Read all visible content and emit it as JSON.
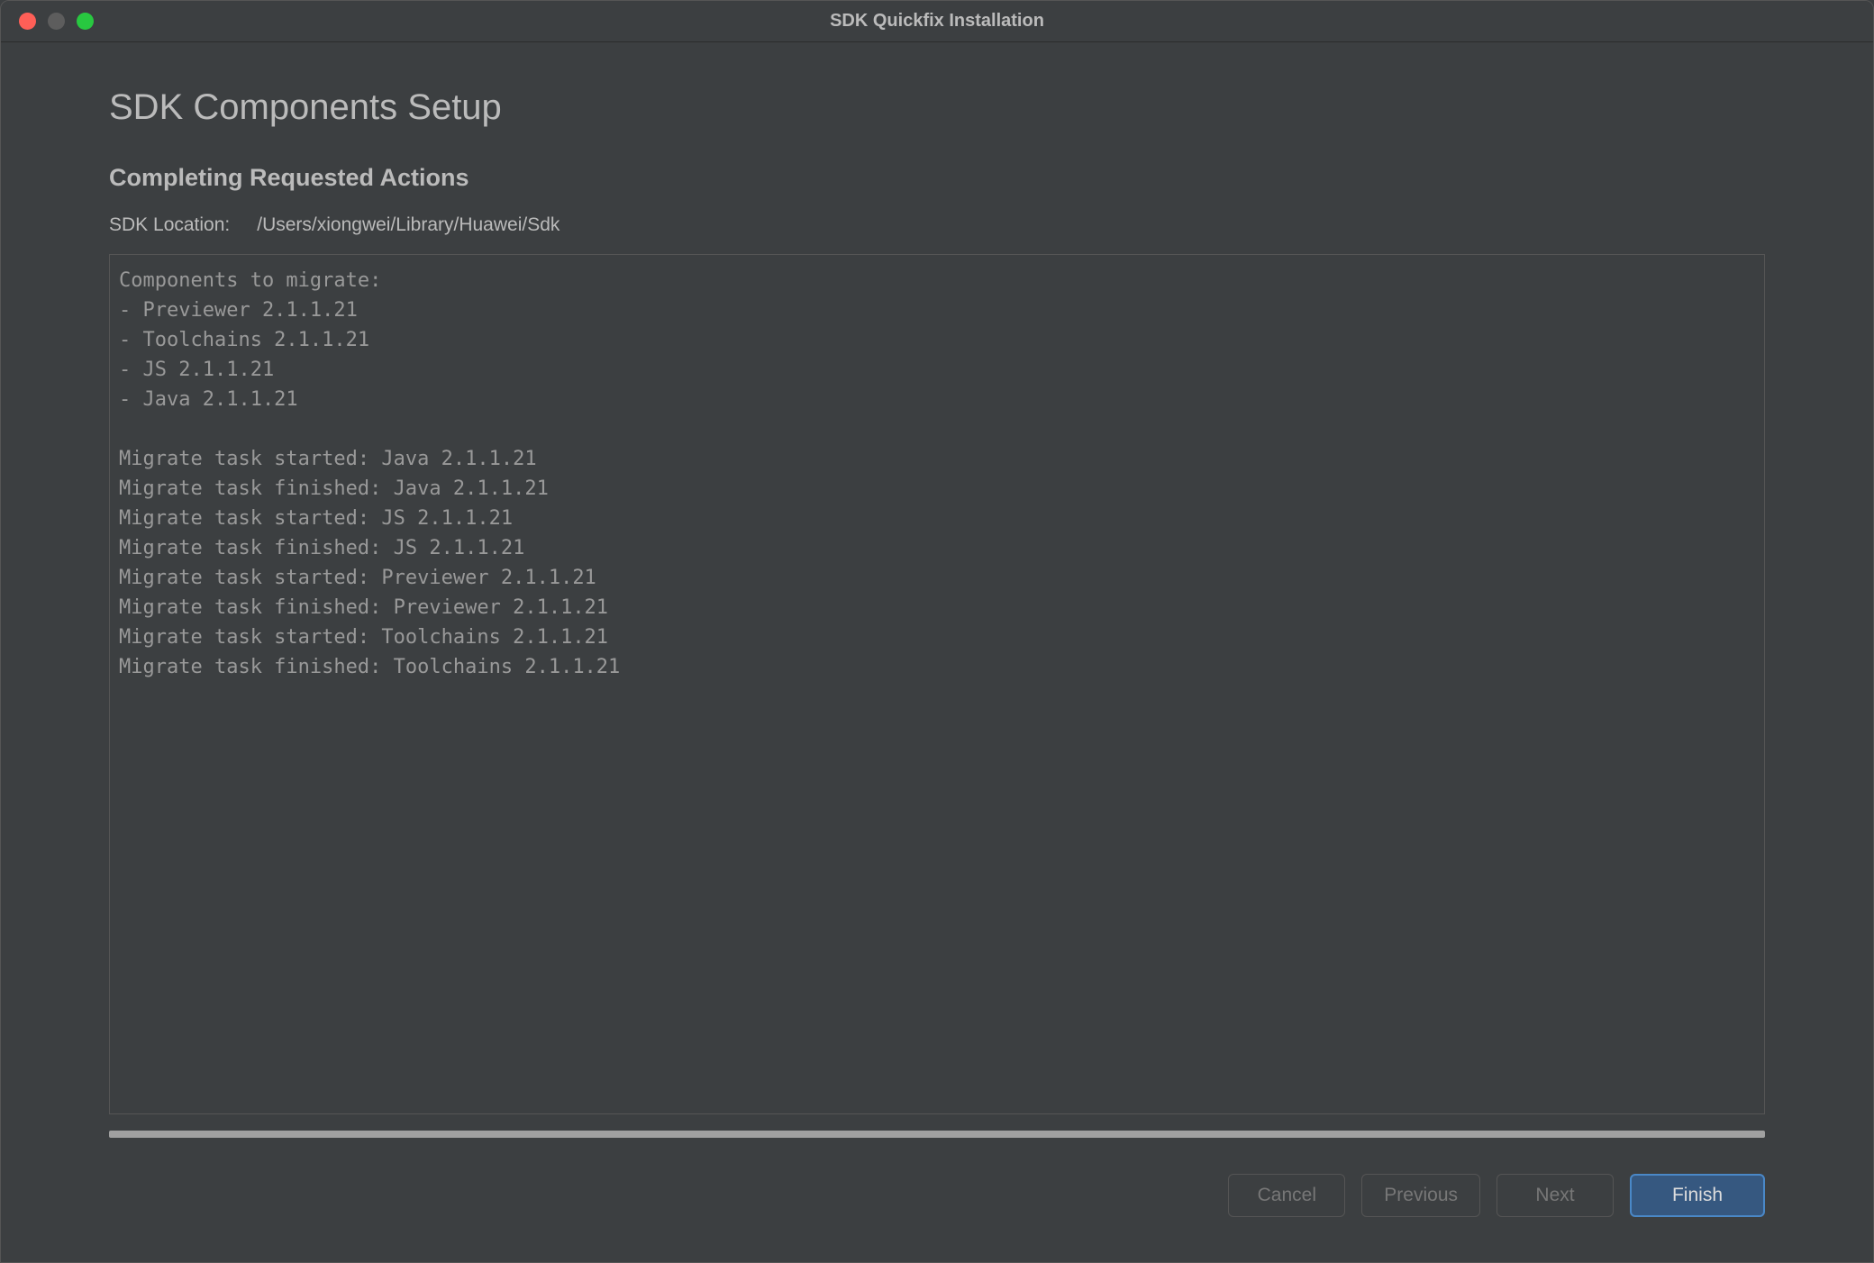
{
  "window": {
    "title": "SDK Quickfix Installation"
  },
  "header": {
    "main_title": "SDK Components Setup",
    "subtitle": "Completing Requested Actions",
    "sdk_location_label": "SDK Location:",
    "sdk_location_value": "/Users/xiongwei/Library/Huawei/Sdk"
  },
  "log": {
    "text": "Components to migrate:\n- Previewer 2.1.1.21\n- Toolchains 2.1.1.21\n- JS 2.1.1.21\n- Java 2.1.1.21\n\nMigrate task started: Java 2.1.1.21\nMigrate task finished: Java 2.1.1.21\nMigrate task started: JS 2.1.1.21\nMigrate task finished: JS 2.1.1.21\nMigrate task started: Previewer 2.1.1.21\nMigrate task finished: Previewer 2.1.1.21\nMigrate task started: Toolchains 2.1.1.21\nMigrate task finished: Toolchains 2.1.1.21"
  },
  "buttons": {
    "cancel": "Cancel",
    "previous": "Previous",
    "next": "Next",
    "finish": "Finish"
  }
}
